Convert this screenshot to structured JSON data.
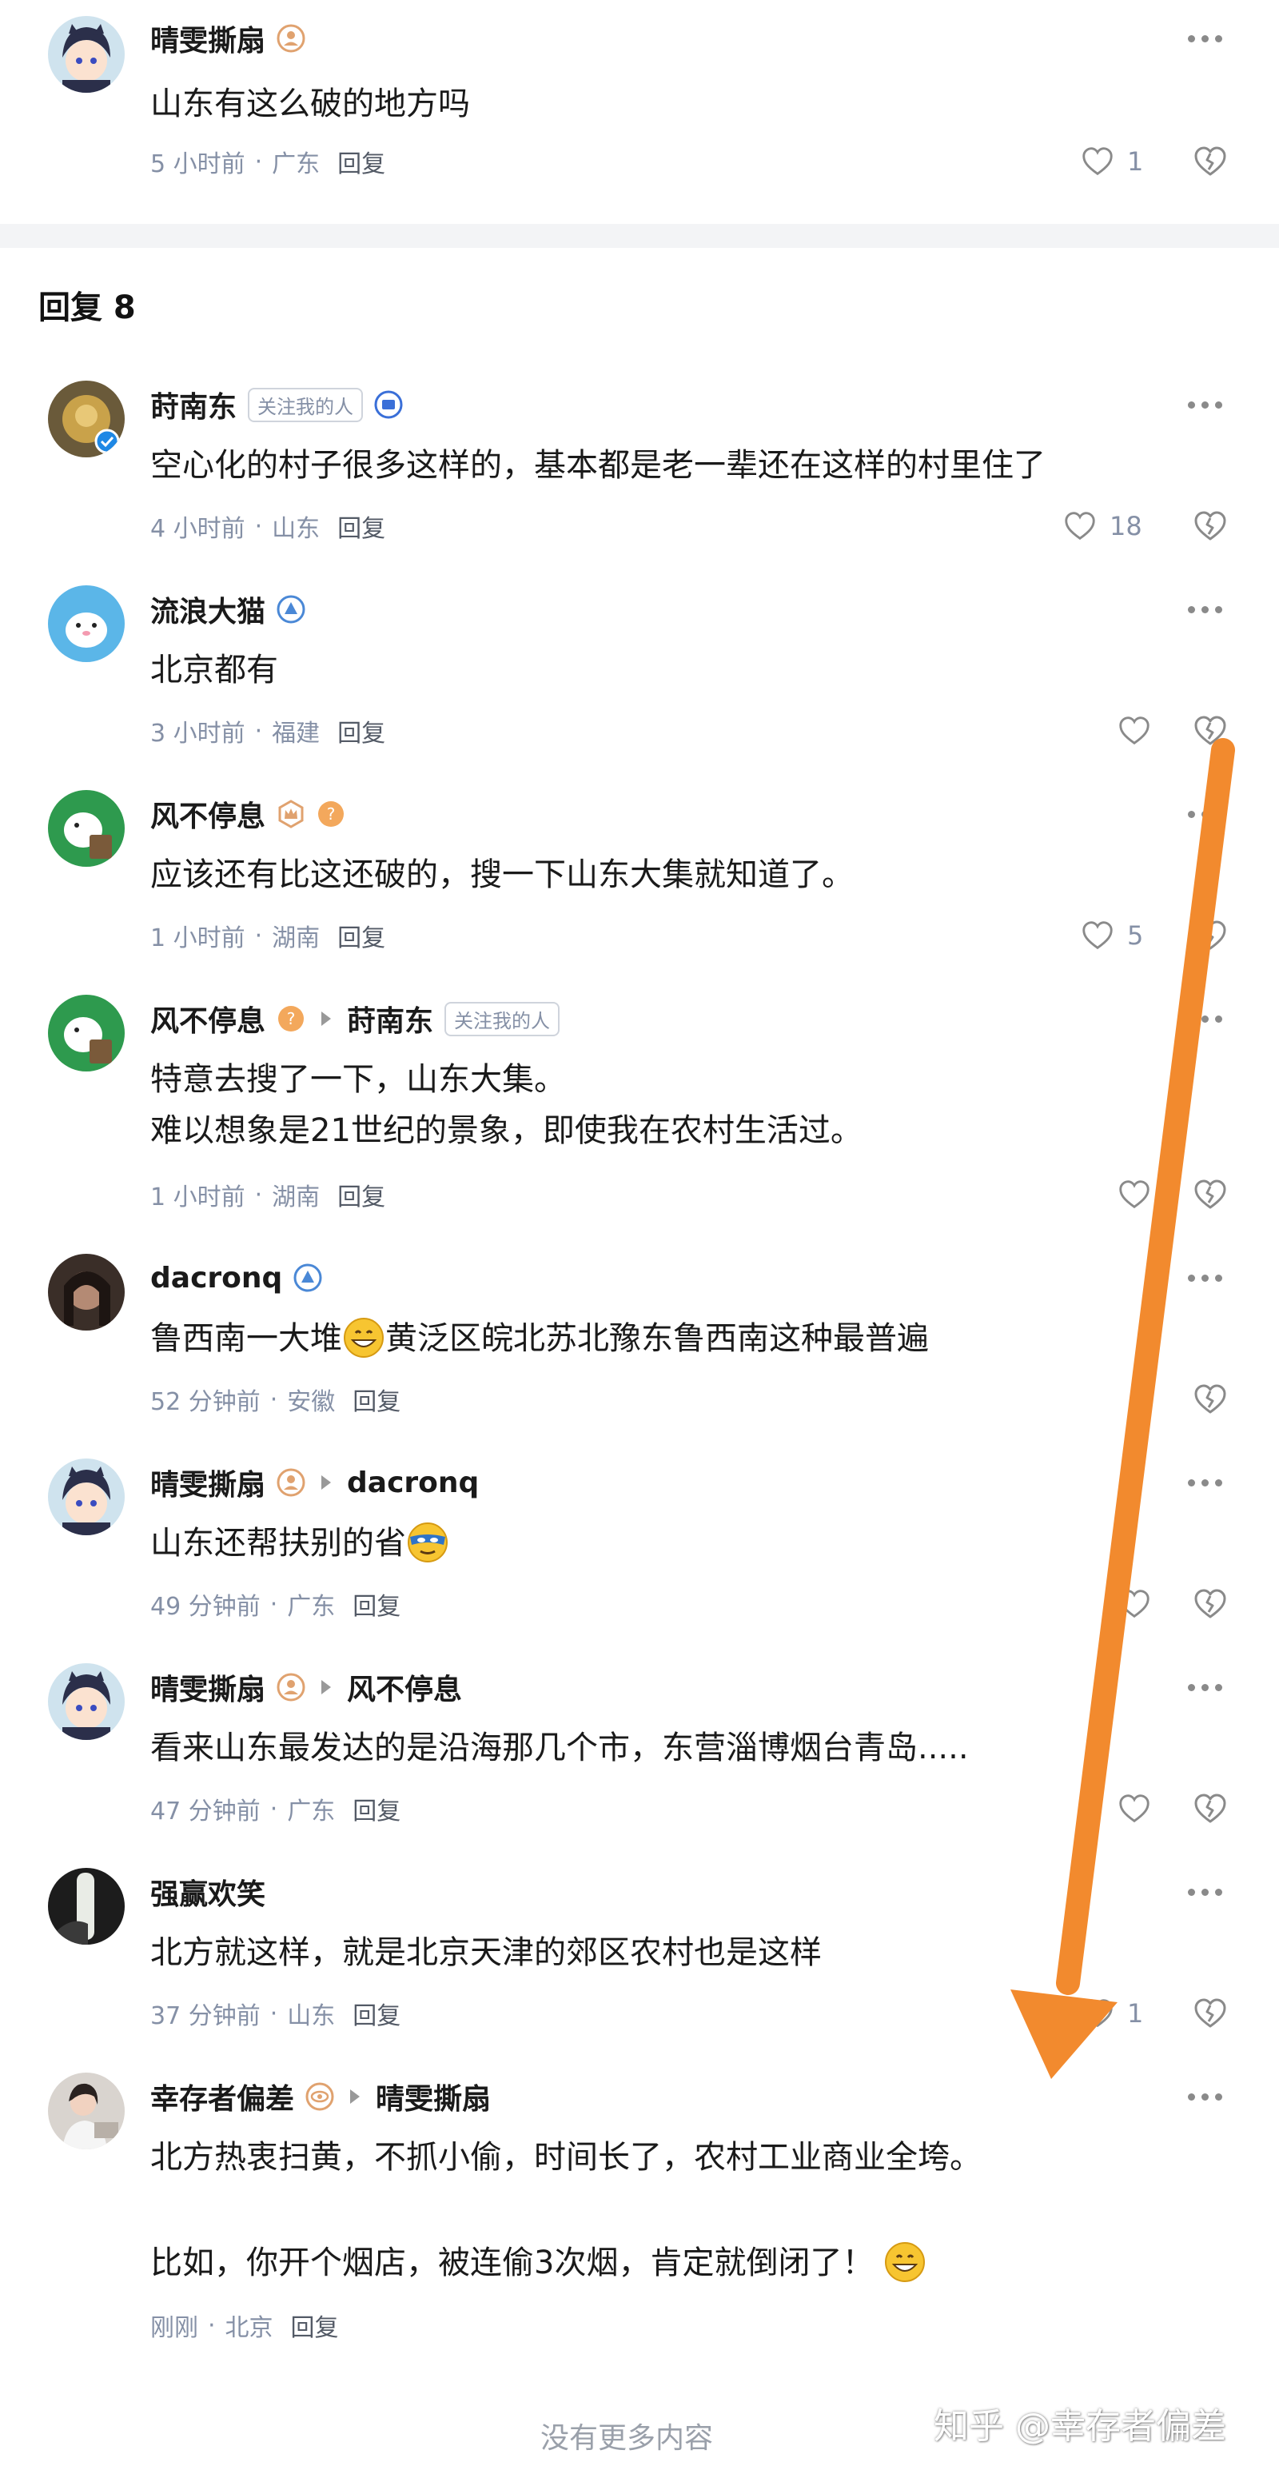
{
  "top_comment": {
    "user": "晴雯撕扇",
    "text": "山东有这么破的地方吗",
    "time": "5 小时前",
    "location": "广东",
    "reply_label": "回复",
    "likes": "1"
  },
  "replies_header": "回复 8",
  "comments": [
    {
      "user": "莳南东",
      "tag": "关注我的人",
      "lines": [
        "空心化的村子很多这样的，基本都是老一辈还在这样的村里住了"
      ],
      "time": "4 小时前",
      "location": "山东",
      "reply_label": "回复",
      "likes": "18"
    },
    {
      "user": "流浪大猫",
      "lines": [
        "北京都有"
      ],
      "time": "3 小时前",
      "location": "福建",
      "reply_label": "回复",
      "likes": ""
    },
    {
      "user": "风不停息",
      "lines": [
        "应该还有比这还破的，搜一下山东大集就知道了。"
      ],
      "time": "1 小时前",
      "location": "湖南",
      "reply_label": "回复",
      "likes": "5"
    },
    {
      "user": "风不停息",
      "reply_to": "莳南东",
      "reply_to_tag": "关注我的人",
      "lines": [
        "特意去搜了一下，山东大集。",
        "难以想象是21世纪的景象，即使我在农村生活过。"
      ],
      "time": "1 小时前",
      "location": "湖南",
      "reply_label": "回复",
      "likes": ""
    },
    {
      "user": "dacronq",
      "lines": [
        "鲁西南一大堆"
      ],
      "text_after_emoji": "黄泛区皖北苏北豫东鲁西南这种最普遍",
      "time": "52 分钟前",
      "location": "安徽",
      "reply_label": "回复",
      "likes": ""
    },
    {
      "user": "晴雯撕扇",
      "reply_to": "dacronq",
      "lines": [
        "山东还帮扶别的省"
      ],
      "time": "49 分钟前",
      "location": "广东",
      "reply_label": "回复",
      "likes": ""
    },
    {
      "user": "晴雯撕扇",
      "reply_to": "风不停息",
      "lines": [
        "看来山东最发达的是沿海那几个市，东营淄博烟台青岛....."
      ],
      "time": "47 分钟前",
      "location": "广东",
      "reply_label": "回复",
      "likes": ""
    },
    {
      "user": "强赢欢笑",
      "lines": [
        "北方就这样，就是北京天津的郊区农村也是这样"
      ],
      "time": "37 分钟前",
      "location": "山东",
      "reply_label": "回复",
      "likes": "1"
    },
    {
      "user": "幸存者偏差",
      "reply_to": "晴雯撕扇",
      "lines": [
        "北方热衷扫黄，不抓小偷，时间长了，农村工业商业全垮。",
        "比如，你开个烟店，被连偷3次烟，肯定就倒闭了！"
      ],
      "time": "刚刚",
      "location": "北京",
      "reply_label": "回复",
      "likes": ""
    }
  ],
  "footer": "没有更多内容",
  "watermark": "知乎 @幸存者偏差",
  "colors": {
    "meta_gray": "#8590a6",
    "divider": "#f3f4f6",
    "annotation_arrow": "#f28a2e",
    "emoji_yellow": "#f7c531"
  },
  "icons": [
    "more-icon",
    "heart-icon",
    "broken-heart-icon",
    "reply-arrow-icon",
    "grin-emoji",
    "mask-emoji"
  ]
}
